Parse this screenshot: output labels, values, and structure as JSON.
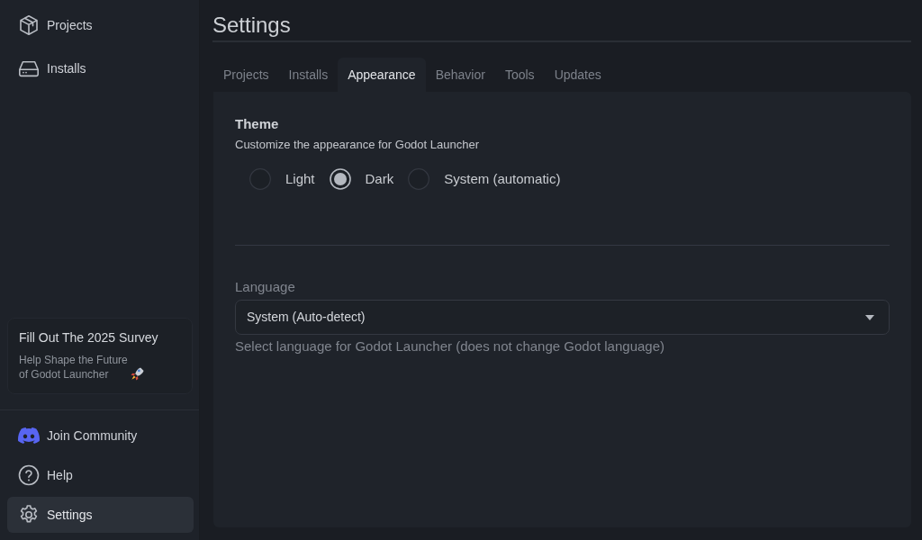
{
  "sidebar": {
    "top_items": [
      {
        "label": "Projects",
        "selected": false
      },
      {
        "label": "Installs",
        "selected": false
      }
    ],
    "survey_card": {
      "title": "Fill Out The 2025 Survey",
      "text": "Help Shape the Future\nof Godot Launcher"
    },
    "bottom_items": [
      {
        "label": "Join Community",
        "selected": false
      },
      {
        "label": "Help",
        "selected": false
      },
      {
        "label": "Settings",
        "selected": true
      }
    ]
  },
  "page": {
    "title": "Settings",
    "tabs": [
      {
        "label": "Projects",
        "selected": false
      },
      {
        "label": "Installs",
        "selected": false
      },
      {
        "label": "Appearance",
        "selected": true
      },
      {
        "label": "Behavior",
        "selected": false
      },
      {
        "label": "Tools",
        "selected": false
      },
      {
        "label": "Updates",
        "selected": false
      }
    ],
    "theme": {
      "title": "Theme",
      "description": "Customize the appearance for Godot Launcher",
      "options": [
        {
          "label": "Light",
          "selected": false
        },
        {
          "label": "Dark",
          "selected": true
        },
        {
          "label": "System (automatic)",
          "selected": false
        }
      ]
    },
    "language": {
      "label": "Language",
      "value": "System (Auto-detect)",
      "help": "Select language for Godot Launcher (does not change Godot language)"
    }
  }
}
